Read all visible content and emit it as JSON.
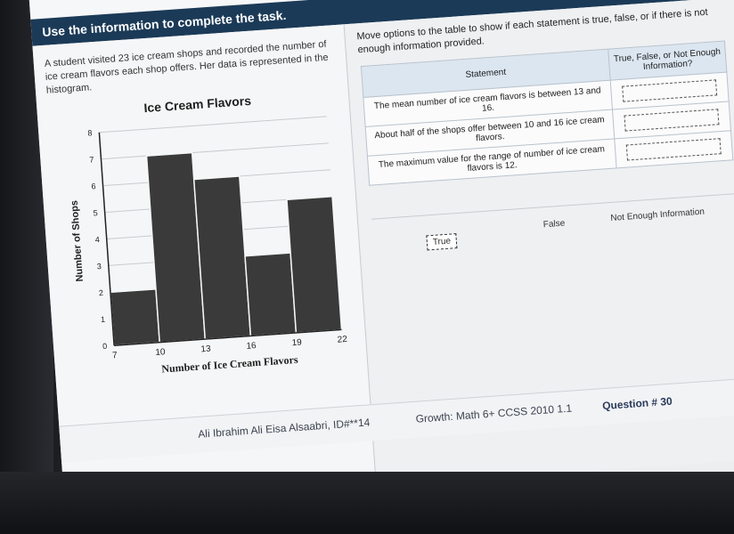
{
  "toolbar": {
    "tools": [
      {
        "icon": "pencil-icon",
        "glyph": "✎"
      },
      {
        "icon": "eraser-icon",
        "glyph": "⌫"
      },
      {
        "icon": "highlighter-icon",
        "glyph": "▬"
      },
      {
        "icon": "line-reader-icon",
        "glyph": "▤"
      },
      {
        "icon": "calculator-icon",
        "glyph": "▦"
      }
    ]
  },
  "task_title": "Use the information to complete the task.",
  "intro": "A student visited 23 ice cream shops and recorded the number of ice cream flavors each shop offers. Her data is represented in the histogram.",
  "instructions": "Move options to the table to show if each statement is true, false, or if there is not enough information provided.",
  "table": {
    "col_statement": "Statement",
    "col_answer": "True, False, or Not Enough Information?",
    "rows": [
      {
        "statement": "The mean number of ice cream flavors is between 13 and 16."
      },
      {
        "statement": "About half of the shops offer between 10 and 16 ice cream flavors."
      },
      {
        "statement": "The maximum value for the range of number of ice cream flavors is 12."
      }
    ]
  },
  "options": {
    "true_label": "True",
    "false_label": "False",
    "not_enough_label": "Not Enough Information"
  },
  "footer": {
    "student": "Ali Ibrahim Ali Eisa Alsaabri, ID#**14",
    "growth": "Growth: Math 6+ CCSS 2010 1.1",
    "question": "Question # 30"
  },
  "colors": {
    "bar": "#3a3a3a",
    "banner": "#1b3a57"
  },
  "chart_data": {
    "type": "bar",
    "title": "Ice Cream Flavors",
    "xlabel": "Number of Ice Cream Flavors",
    "ylabel": "Number of Shops",
    "bin_edges": [
      7,
      10,
      13,
      16,
      19,
      22
    ],
    "values": [
      2,
      7,
      6,
      3,
      5
    ],
    "ylim": [
      0,
      8
    ],
    "y_ticks": [
      "0",
      "1",
      "2",
      "3",
      "4",
      "5",
      "6",
      "7",
      "8"
    ],
    "x_ticks": [
      "7",
      "10",
      "13",
      "16",
      "19",
      "22"
    ],
    "grid": true
  }
}
